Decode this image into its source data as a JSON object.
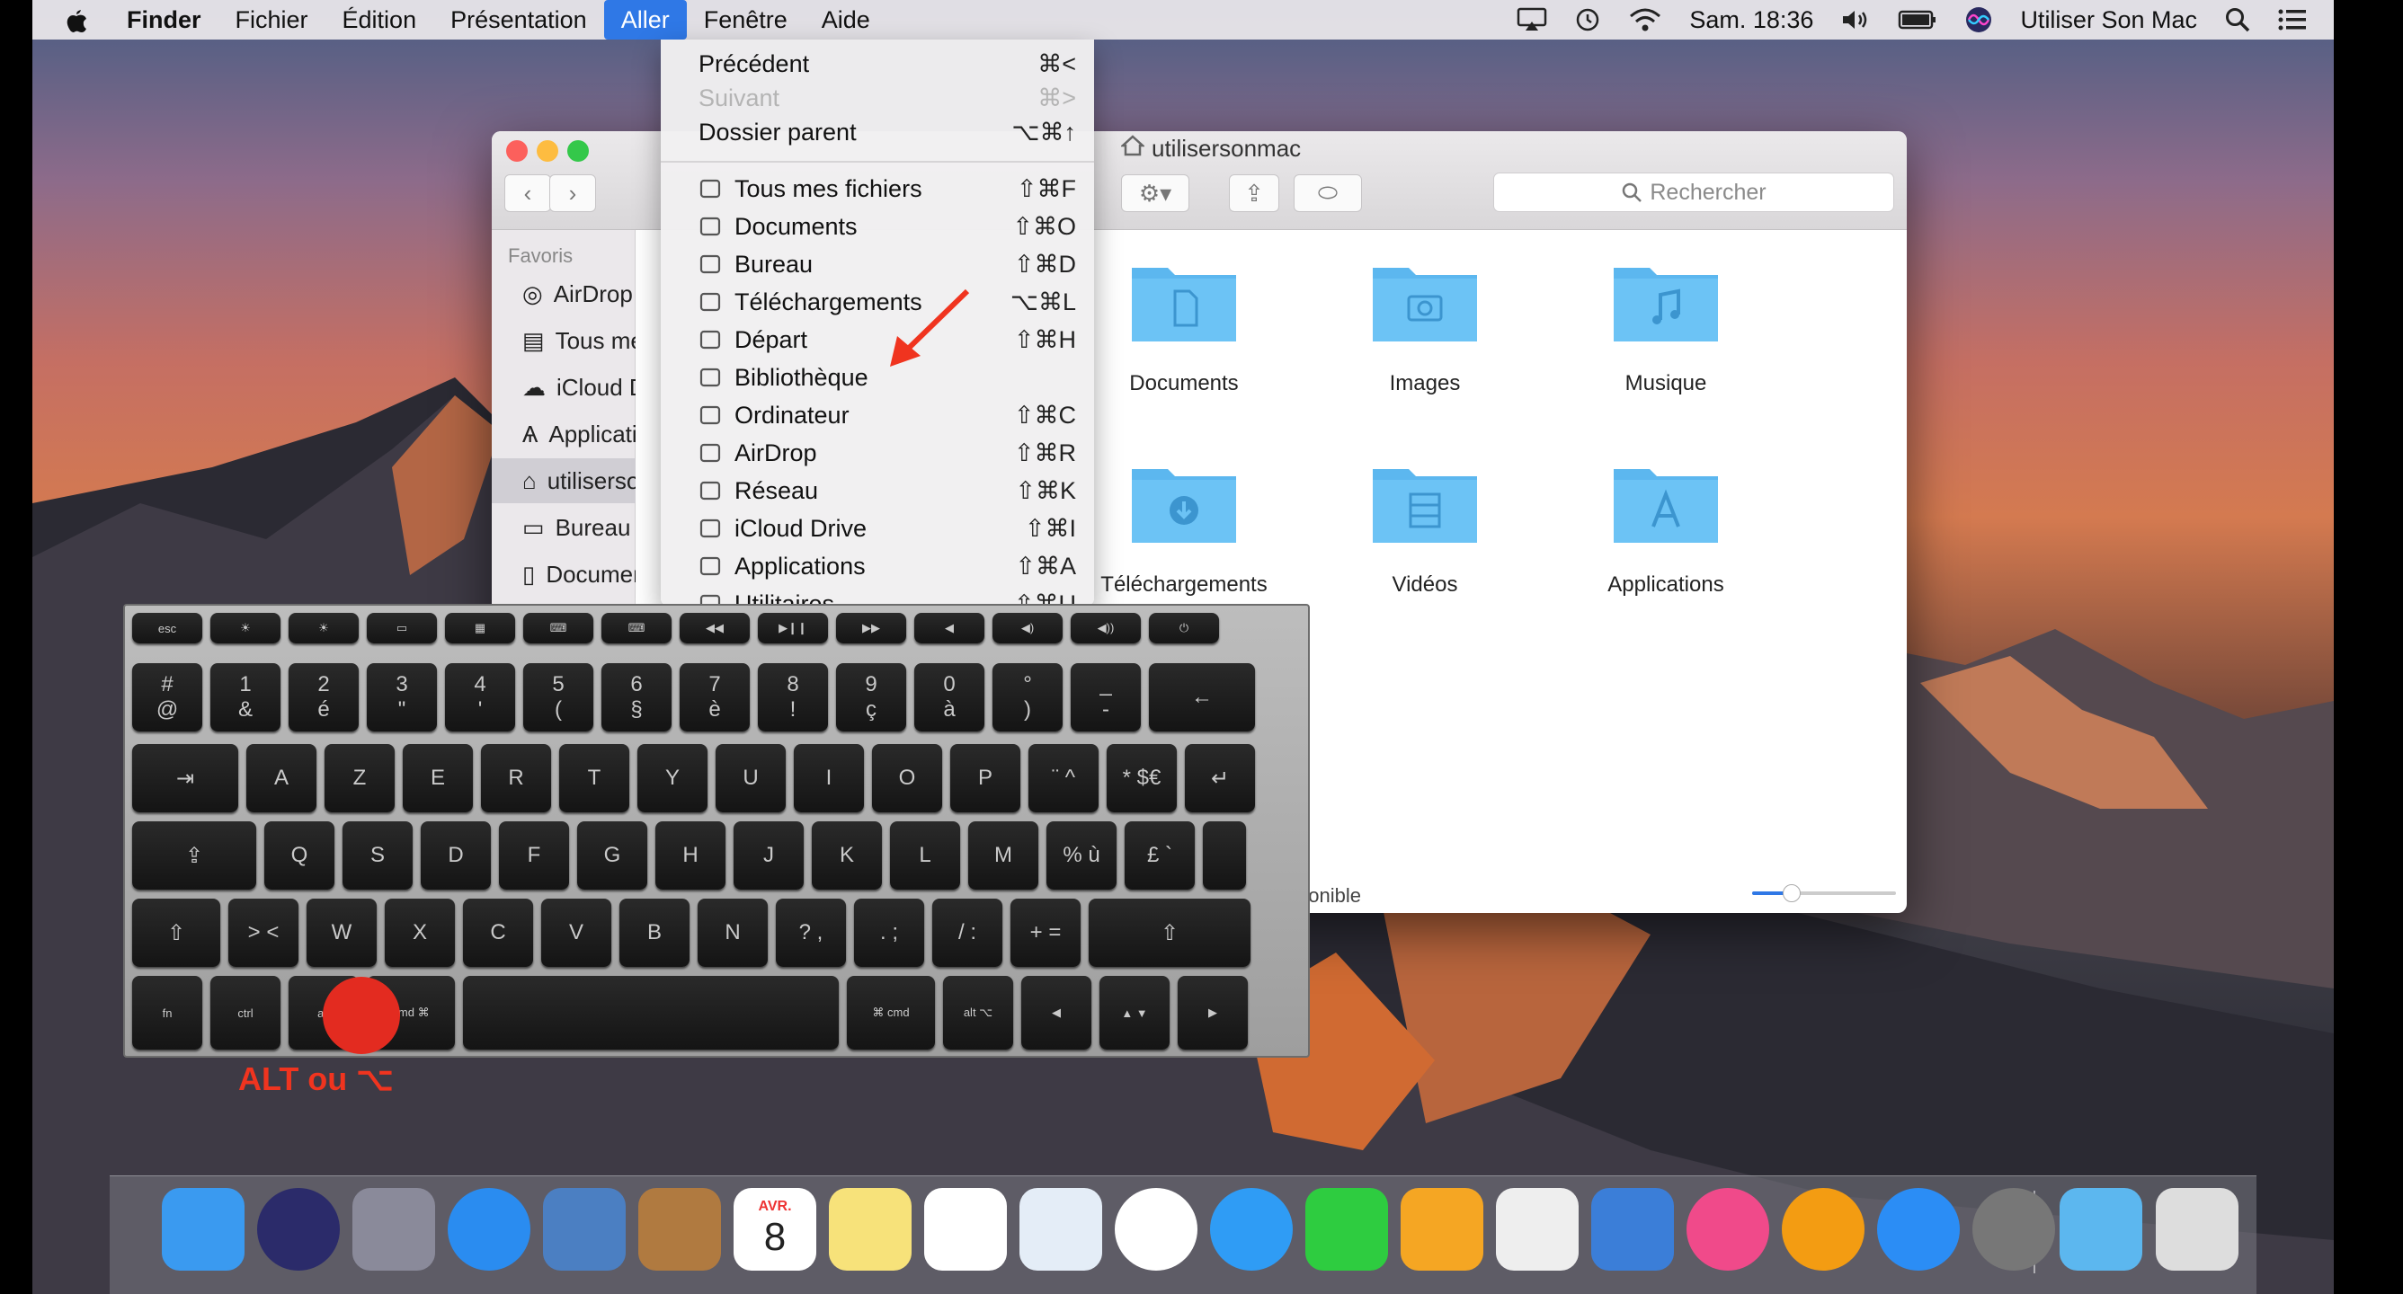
{
  "menubar": {
    "app": "Finder",
    "items": [
      "Fichier",
      "Édition",
      "Présentation",
      "Aller",
      "Fenêtre",
      "Aide"
    ],
    "clock": "Sam. 18:36",
    "user": "Utiliser Son Mac"
  },
  "go_menu": {
    "items": [
      {
        "label": "Précédent",
        "shortcut": "⌘<",
        "icon": "",
        "disabled": false
      },
      {
        "label": "Suivant",
        "shortcut": "⌘>",
        "icon": "",
        "disabled": true
      },
      {
        "label": "Dossier parent",
        "shortcut": "⌥⌘↑",
        "icon": "",
        "disabled": false
      },
      {
        "label": "Tous mes fichiers",
        "shortcut": "⇧⌘F",
        "icon": "all-files-icon"
      },
      {
        "label": "Documents",
        "shortcut": "⇧⌘O",
        "icon": "documents-icon"
      },
      {
        "label": "Bureau",
        "shortcut": "⇧⌘D",
        "icon": "desktop-icon"
      },
      {
        "label": "Téléchargements",
        "shortcut": "⌥⌘L",
        "icon": "downloads-icon"
      },
      {
        "label": "Départ",
        "shortcut": "⇧⌘H",
        "icon": "home-icon"
      },
      {
        "label": "Bibliothèque",
        "shortcut": "",
        "icon": "library-icon"
      },
      {
        "label": "Ordinateur",
        "shortcut": "⇧⌘C",
        "icon": "computer-icon"
      },
      {
        "label": "AirDrop",
        "shortcut": "⇧⌘R",
        "icon": "airdrop-icon"
      },
      {
        "label": "Réseau",
        "shortcut": "⇧⌘K",
        "icon": "network-icon"
      },
      {
        "label": "iCloud Drive",
        "shortcut": "⇧⌘I",
        "icon": "icloud-icon"
      },
      {
        "label": "Applications",
        "shortcut": "⇧⌘A",
        "icon": "applications-icon"
      },
      {
        "label": "Utilitaires",
        "shortcut": "⇧⌘U",
        "icon": "utilities-icon"
      }
    ]
  },
  "finder": {
    "title": "utilisersonmac",
    "search_placeholder": "Rechercher",
    "sidebar_heading": "Favoris",
    "sidebar": [
      "AirDrop",
      "Tous mes fichiers",
      "iCloud Drive",
      "Applications",
      "utilisersonmac",
      "Bureau",
      "Documents"
    ],
    "folders": [
      "Documents",
      "Images",
      "Musique",
      "Téléchargements",
      "Vidéos",
      "Applications"
    ],
    "status": "ponible"
  },
  "keyboard": {
    "fn_row": [
      "esc",
      "☀",
      "☀",
      "▭",
      "▦",
      "⌨",
      "⌨",
      "◀◀",
      "▶❙❙",
      "▶▶",
      "◀",
      "◀)",
      "◀))",
      "⏻"
    ],
    "row1": [
      [
        "#",
        "@"
      ],
      [
        "1",
        "&"
      ],
      [
        "2",
        "é"
      ],
      [
        "3",
        "\""
      ],
      [
        "4",
        "'"
      ],
      [
        "5",
        "("
      ],
      [
        "6",
        "§"
      ],
      [
        "7",
        "è"
      ],
      [
        "8",
        "!"
      ],
      [
        "9",
        "ç"
      ],
      [
        "0",
        "à"
      ],
      [
        "°",
        ")"
      ],
      [
        "_",
        "-"
      ],
      [
        "←",
        ""
      ]
    ],
    "row2": [
      "⇥",
      "A",
      "Z",
      "E",
      "R",
      "T",
      "Y",
      "U",
      "I",
      "O",
      "P",
      "¨ ^",
      "* $€",
      "↵"
    ],
    "row3": [
      "⇪",
      "Q",
      "S",
      "D",
      "F",
      "G",
      "H",
      "J",
      "K",
      "L",
      "M",
      "% ù",
      "£ `",
      ""
    ],
    "row4": [
      "⇧",
      "> <",
      "W",
      "X",
      "C",
      "V",
      "B",
      "N",
      "? ,",
      ". ;",
      "/ :",
      "+ =",
      "⇧"
    ],
    "row5": [
      "fn",
      "ctrl",
      "alt",
      "cmd ⌘",
      "",
      "⌘ cmd",
      "alt ⌥",
      "◀",
      "▲ ▼",
      "▶"
    ],
    "highlight_label": "ALT ou  ⌥"
  },
  "dock": [
    "Finder",
    "Siri",
    "Launchpad",
    "Safari",
    "Mail",
    "Contacts",
    "Calendrier",
    "Notes",
    "Rappels",
    "Aperçu",
    "Photos",
    "Messages",
    "FaceTime",
    "Pages",
    "Numbers",
    "Keynote",
    "iTunes",
    "iBooks",
    "App Store",
    "Préférences Système",
    "Téléchargements",
    "Corbeille"
  ],
  "dock_calendar": {
    "month": "AVR.",
    "day": "8"
  },
  "colors": {
    "accent": "#2f78e6",
    "folder": "#5cb7ef",
    "alt_marker": "#e32b20"
  }
}
